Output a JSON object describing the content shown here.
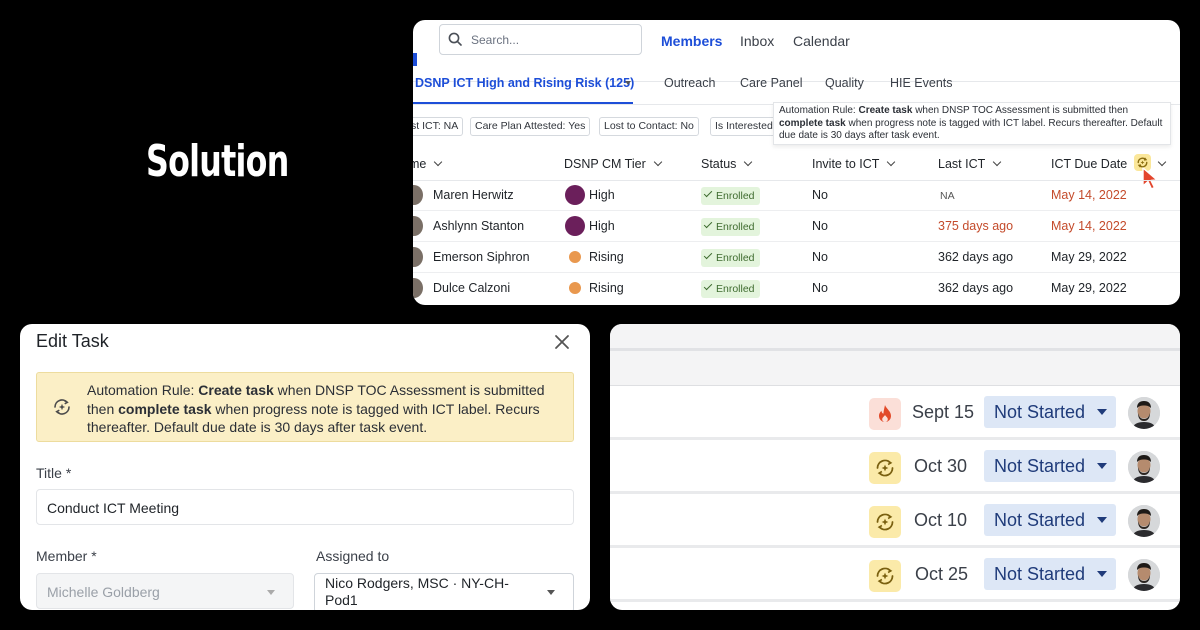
{
  "headline": "Solution",
  "members_panel": {
    "search_placeholder": "Search...",
    "nav": [
      "Members",
      "Inbox",
      "Calendar"
    ],
    "tabs": [
      "DSNP ICT High and Rising Risk (125)",
      "Outreach",
      "Care Panel",
      "Quality",
      "HIE Events"
    ],
    "filters": [
      "st ICT: NA",
      "Care Plan Attested: Yes",
      "Lost to Contact: No",
      "Is Interested"
    ],
    "tooltip": {
      "prefix": "Automation Rule: ",
      "action1": "Create task",
      "mid": " when DNSP TOC Assessment is submitted then ",
      "action2": "complete task",
      "suffix": " when progress note is tagged with ICT label. Recurs thereafter. Default due date is 30 days after task event."
    },
    "columns": [
      "me",
      "DSNP CM Tier",
      "Status",
      "Invite to ICT",
      "Last ICT",
      "ICT Due Date"
    ],
    "rows": [
      {
        "name": "Maren Herwitz",
        "tier": "High",
        "status": "Enrolled",
        "invite": "No",
        "last_ict": "NA",
        "due": "May 14, 2022"
      },
      {
        "name": "Ashlynn Stanton",
        "tier": "High",
        "status": "Enrolled",
        "invite": "No",
        "last_ict": "375 days ago",
        "due": "May 14, 2022"
      },
      {
        "name": "Emerson Siphron",
        "tier": "Rising",
        "status": "Enrolled",
        "invite": "No",
        "last_ict": "362 days ago",
        "due": "May 29, 2022"
      },
      {
        "name": "Dulce Calzoni",
        "tier": "Rising",
        "status": "Enrolled",
        "invite": "No",
        "last_ict": "362 days ago",
        "due": "May 29, 2022"
      }
    ],
    "colors": {
      "accent": "#1d4ed8",
      "high": "#6b1f5b",
      "rising": "#e9984e",
      "overdue": "#c44b2b",
      "enrolled_bg": "#e3f4dc"
    }
  },
  "edit_task": {
    "title": "Edit Task",
    "alert": {
      "prefix": "Automation Rule: ",
      "action1": "Create task",
      "mid": " when DNSP TOC Assessment is submitted then ",
      "action2": "complete task",
      "suffix": " when progress note is tagged with ICT label. Recurs thereafter. Default due date is 30 days after task event."
    },
    "title_label": "Title *",
    "title_value": "Conduct ICT Meeting",
    "member_label": "Member *",
    "member_value": "Michelle Goldberg",
    "assigned_label": "Assigned to",
    "assigned_value_line1": "Nico Rodgers, MSC · NY-CH-",
    "assigned_value_line2": "Pod1"
  },
  "task_list": {
    "rows": [
      {
        "icon": "fire-icon",
        "date": "Sept 15",
        "status": "Not Started"
      },
      {
        "icon": "automation-rule-icon",
        "date": "Oct 30",
        "status": "Not Started"
      },
      {
        "icon": "automation-rule-icon",
        "date": "Oct 10",
        "status": "Not Started"
      },
      {
        "icon": "automation-rule-icon",
        "date": "Oct 25",
        "status": "Not Started"
      }
    ]
  }
}
